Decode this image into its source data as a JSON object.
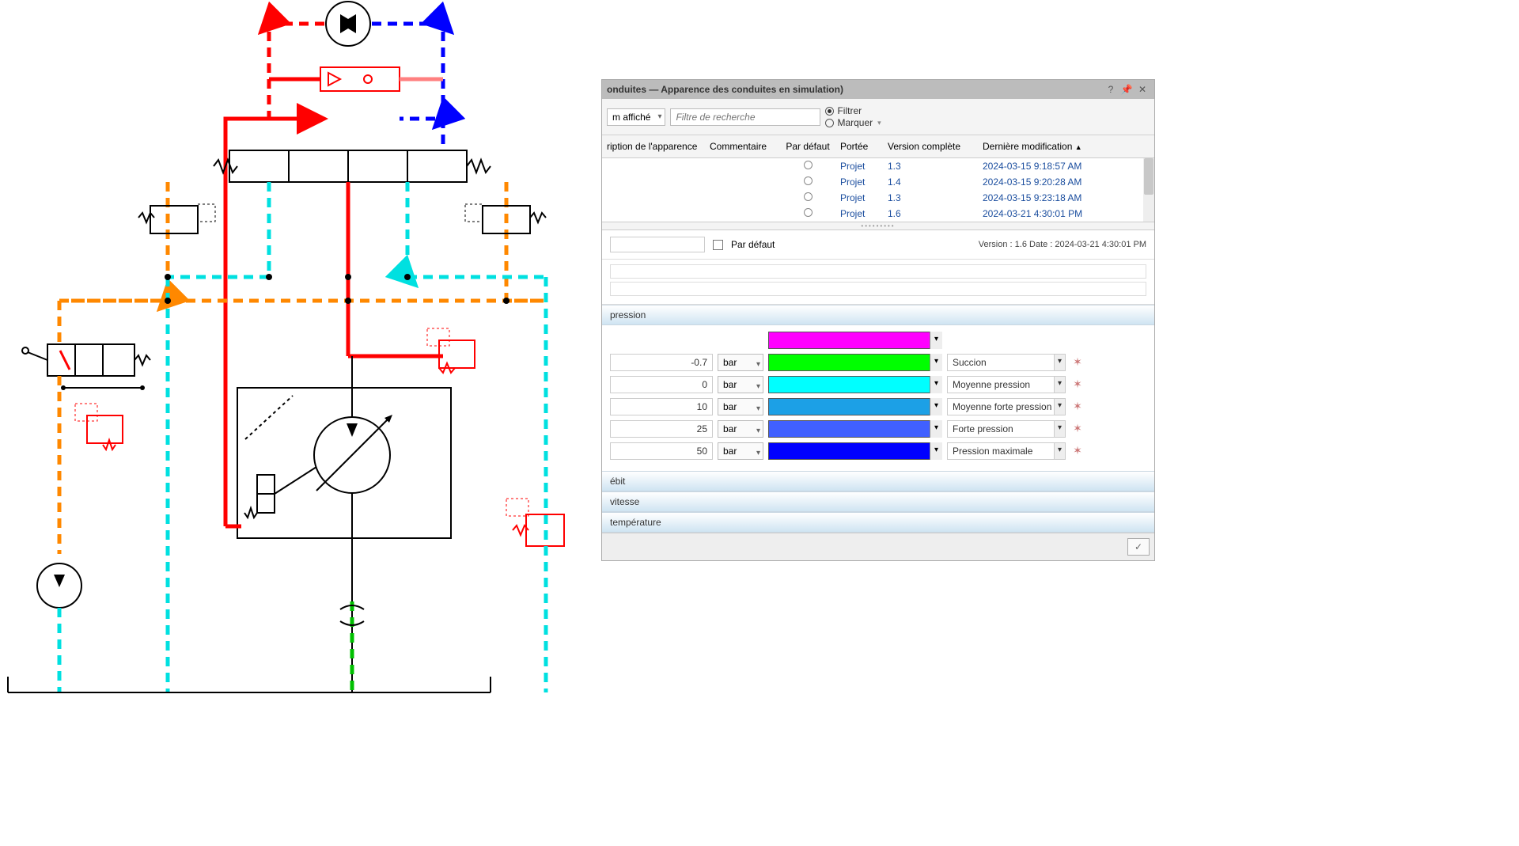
{
  "dialog": {
    "title": "onduites — Apparence des conduites en simulation)",
    "display_dd": "m affiché",
    "search_placeholder": "Filtre de recherche",
    "filter_label": "Filtrer",
    "mark_label": "Marquer",
    "columns": {
      "desc": "ription de l'apparence",
      "comment": "Commentaire",
      "default": "Par défaut",
      "scope": "Portée",
      "version": "Version complète",
      "modified": "Dernière modification"
    },
    "rows": [
      {
        "scope": "Projet",
        "version": "1.3",
        "modified": "2024-03-15 9:18:57 AM"
      },
      {
        "scope": "Projet",
        "version": "1.4",
        "modified": "2024-03-15 9:20:28 AM"
      },
      {
        "scope": "Projet",
        "version": "1.3",
        "modified": "2024-03-15 9:23:18 AM"
      },
      {
        "scope": "Projet",
        "version": "1.6",
        "modified": "2024-03-21 4:30:01 PM"
      }
    ],
    "default_checkbox_label": "Par défaut",
    "version_info": "Version :  1.6  Date :  2024-03-21 4:30:01 PM"
  },
  "sections": {
    "pressure": "pression",
    "flow": "ébit",
    "speed": "vitesse",
    "temperature": "température"
  },
  "pressure_rows": [
    {
      "value": "",
      "unit": "",
      "color": "#ff00ff",
      "label": ""
    },
    {
      "value": "-0.7",
      "unit": "bar",
      "color": "#00ff00",
      "label": "Succion"
    },
    {
      "value": "0",
      "unit": "bar",
      "color": "#00ffff",
      "label": "Moyenne pression"
    },
    {
      "value": "10",
      "unit": "bar",
      "color": "#1ca0e6",
      "label": "Moyenne forte pression"
    },
    {
      "value": "25",
      "unit": "bar",
      "color": "#4060ff",
      "label": "Forte pression"
    },
    {
      "value": "50",
      "unit": "bar",
      "color": "#0000ff",
      "label": "Pression maximale"
    }
  ]
}
